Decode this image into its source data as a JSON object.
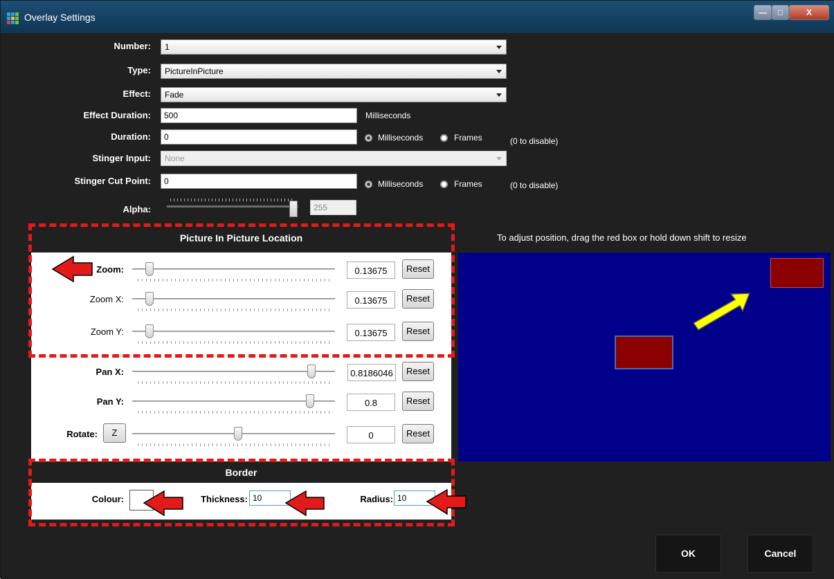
{
  "window": {
    "title": "Overlay Settings",
    "minimize": "—",
    "maximize": "□",
    "close": "X"
  },
  "form": {
    "number": {
      "label": "Number:",
      "value": "1"
    },
    "type": {
      "label": "Type:",
      "value": "PictureInPicture"
    },
    "effect": {
      "label": "Effect:",
      "value": "Fade"
    },
    "effect_duration": {
      "label": "Effect Duration:",
      "value": "500",
      "unit": "Milliseconds"
    },
    "duration": {
      "label": "Duration:",
      "value": "0",
      "opt1": "Milliseconds",
      "opt2": "Frames",
      "note": "(0 to disable)"
    },
    "stinger_input": {
      "label": "Stinger Input:",
      "value": "None"
    },
    "stinger_cut": {
      "label": "Stinger Cut Point:",
      "value": "0",
      "opt1": "Milliseconds",
      "opt2": "Frames",
      "note": "(0 to disable)"
    },
    "alpha": {
      "label": "Alpha:",
      "value": "255",
      "level": 1.0
    }
  },
  "pip": {
    "title": "Picture In Picture Location",
    "hint": "To adjust position, drag the red box or hold down shift to resize",
    "sliders": [
      {
        "label": "Zoom:",
        "value": "0.13675",
        "pos": 0.13675,
        "reset": "Reset"
      },
      {
        "label": "Zoom X:",
        "value": "0.13675",
        "pos": 0.13675,
        "reset": "Reset"
      },
      {
        "label": "Zoom Y:",
        "value": "0.13675",
        "pos": 0.13675,
        "reset": "Reset"
      },
      {
        "label": "Pan X:",
        "value": "0.8186046",
        "pos": 0.9093,
        "reset": "Reset"
      },
      {
        "label": "Pan Y:",
        "value": "0.8",
        "pos": 0.9,
        "reset": "Reset"
      },
      {
        "label": "Rotate:",
        "value": "0",
        "pos": 0.5,
        "reset": "Reset"
      }
    ],
    "rotate_button": "Z"
  },
  "border": {
    "title": "Border",
    "colour_label": "Colour:",
    "thickness_label": "Thickness:",
    "thickness_value": "10",
    "radius_label": "Radius:",
    "radius_value": "10"
  },
  "buttons": {
    "ok": "OK",
    "cancel": "Cancel"
  },
  "colors": {
    "preview_bg": "#00008b",
    "box": "#8b0000",
    "annotation": "#e31a1a",
    "arrow_yellow": "#ffff00"
  }
}
